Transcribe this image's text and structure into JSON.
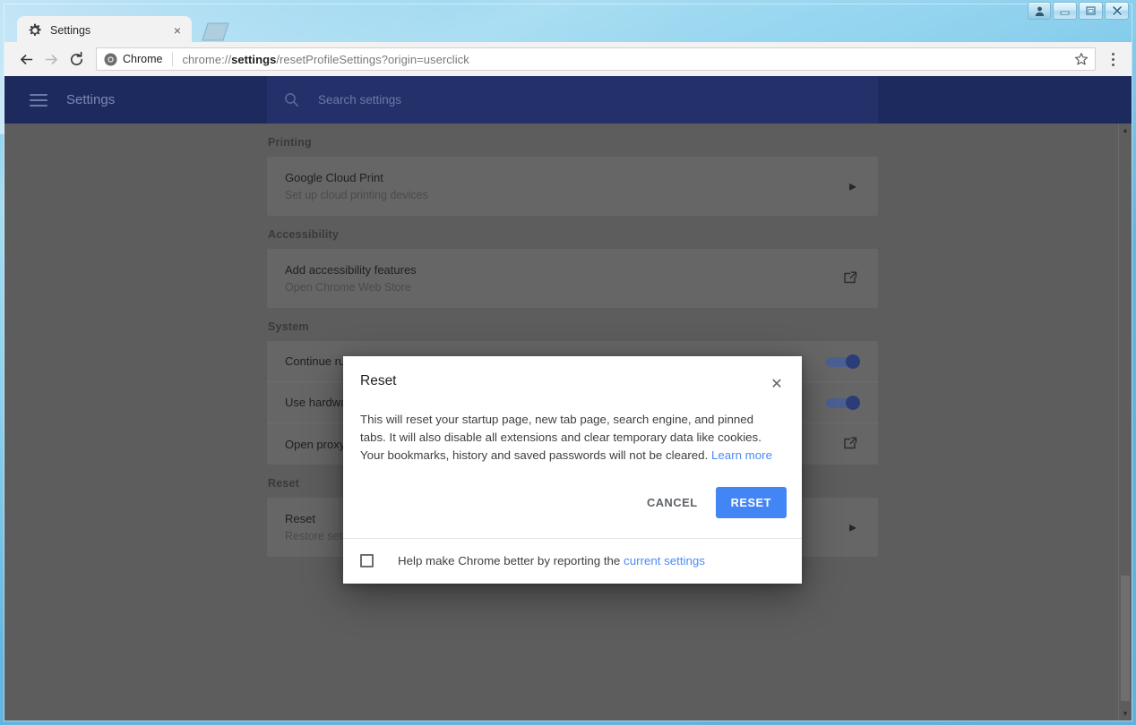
{
  "window": {
    "controls": [
      {
        "name": "user-account-button",
        "label": "user"
      },
      {
        "name": "minimize-button",
        "label": "minimize"
      },
      {
        "name": "maximize-button",
        "label": "maximize"
      },
      {
        "name": "close-button",
        "label": "close"
      }
    ]
  },
  "browser": {
    "tab": {
      "title": "Settings",
      "favicon": "gear-icon",
      "close_label": "×"
    },
    "new_tab_label": "+",
    "nav": {
      "back_label": "Back",
      "forward_label": "Forward",
      "reload_label": "Reload"
    },
    "omnibox": {
      "chip_label": "Chrome",
      "url_prefix": "chrome://",
      "url_bold": "settings",
      "url_suffix": "/resetProfileSettings?origin=userclick",
      "full_url": "chrome://settings/resetProfileSettings?origin=userclick",
      "star_label": "Bookmark this page"
    },
    "menu_label": "Customize and control Google Chrome"
  },
  "settings": {
    "header": {
      "menu_label": "Main menu",
      "title": "Settings",
      "search_placeholder": "Search settings"
    },
    "sections": [
      {
        "label": "Printing",
        "rows": [
          {
            "title": "Google Cloud Print",
            "subtitle": "Set up cloud printing devices",
            "control": "chevron",
            "control_glyph": "▸"
          }
        ]
      },
      {
        "label": "Accessibility",
        "rows": [
          {
            "title": "Add accessibility features",
            "subtitle": "Open Chrome Web Store",
            "control": "external",
            "control_glyph": ""
          }
        ]
      },
      {
        "label": "System",
        "rows": [
          {
            "title": "Continue running background apps when Google Chrome is closed",
            "subtitle": "",
            "control": "toggle",
            "toggle_on": true
          },
          {
            "title": "Use hardware acceleration when available",
            "subtitle": "",
            "control": "toggle",
            "toggle_on": true
          },
          {
            "title": "Open proxy settings",
            "subtitle": "",
            "control": "external",
            "control_glyph": ""
          }
        ]
      },
      {
        "label": "Reset",
        "rows": [
          {
            "title": "Reset",
            "subtitle": "Restore settings to their original defaults",
            "control": "chevron",
            "control_glyph": "▸"
          }
        ]
      }
    ],
    "scrollbar": {
      "up_glyph": "▴",
      "down_glyph": "▾"
    }
  },
  "dialog": {
    "title": "Reset",
    "close_glyph": "✕",
    "body_text": "This will reset your startup page, new tab page, search engine, and pinned tabs. It will also disable all extensions and clear temporary data like cookies. Your bookmarks, history and saved passwords will not be cleared.",
    "learn_more_label": "Learn more",
    "cancel_label": "CANCEL",
    "confirm_label": "RESET",
    "footer_text_before": "Help make Chrome better by reporting the",
    "footer_link_label": "current settings",
    "checkbox_checked": false
  },
  "colors": {
    "accent_blue": "#4285f4",
    "link_blue": "#4a8bf5",
    "settings_header": "#1d2a5e",
    "overlay_gray": "#5d5d5d",
    "card_gray": "#666666",
    "frame_blue": "#63b6e0"
  }
}
